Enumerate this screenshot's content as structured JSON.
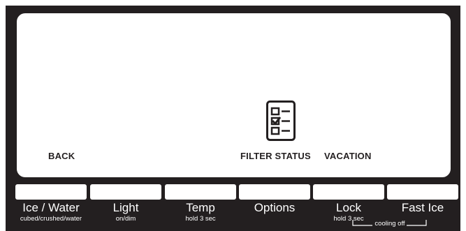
{
  "screen": {
    "back_label": "BACK",
    "filter_status_label": "FILTER STATUS",
    "vacation_label": "VACATION",
    "filter_icon": "checklist-icon"
  },
  "buttons": [
    {
      "label": "Ice / Water",
      "sub": "cubed/crushed/water"
    },
    {
      "label": "Light",
      "sub": "on/dim"
    },
    {
      "label": "Temp",
      "sub": "hold 3 sec"
    },
    {
      "label": "Options",
      "sub": ""
    },
    {
      "label": "Lock",
      "sub": "hold 3 sec"
    },
    {
      "label": "Fast Ice",
      "sub": ""
    }
  ],
  "cooling_off_label": "cooling off",
  "colors": {
    "panel": "#231f20",
    "screen": "#ffffff",
    "text_light": "#ffffff",
    "text_dark": "#231f20"
  }
}
